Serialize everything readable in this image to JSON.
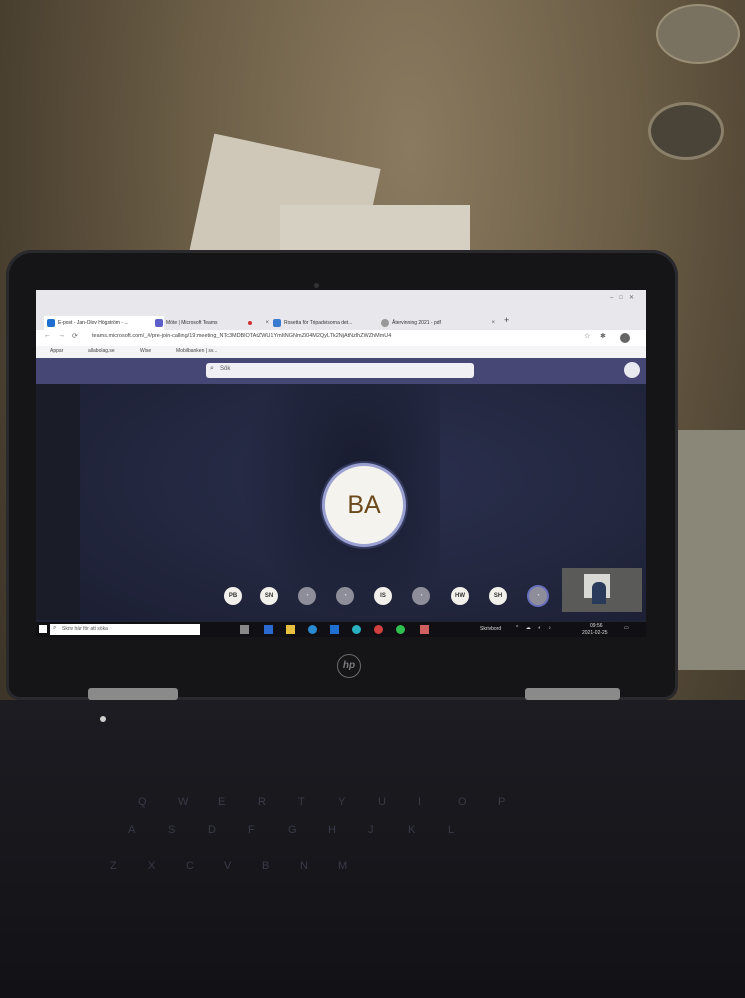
{
  "browser": {
    "tabs": [
      {
        "label": "E-post - Jan-Olov Högström - ..."
      },
      {
        "label": "Möte | Microsoft Teams"
      },
      {
        "label": "Rosetta för Tripadvisorna det..."
      },
      {
        "label": "Återvinning 2021 - pdf"
      }
    ],
    "new_tab": "+",
    "url": "teams.microsoft.com/_#/pre-join-calling/19:meeting_NTc3MDBlOTAtZWU1YmItNGNmZi04M2QyLTk2NjAtNzlhZWZhMmU4"
  },
  "bookmarks": [
    "Appar",
    "allabolag.se",
    "Wise",
    "Mobilbanken | sv..."
  ],
  "teams": {
    "search_placeholder": "Sök",
    "main_participant_initials": "BA",
    "participants": [
      {
        "initials": "PB",
        "has_initials": true
      },
      {
        "initials": "SN",
        "has_initials": true
      },
      {
        "initials": "",
        "has_initials": false
      },
      {
        "initials": "",
        "has_initials": false
      },
      {
        "initials": "IS",
        "has_initials": true
      },
      {
        "initials": "",
        "has_initials": false
      },
      {
        "initials": "HW",
        "has_initials": true
      },
      {
        "initials": "SH",
        "has_initials": true
      },
      {
        "initials": "",
        "has_initials": false
      }
    ]
  },
  "taskbar": {
    "search_placeholder": "Skriv här för att söka",
    "desktop_label": "Skrivbord",
    "time": "09:56",
    "date": "2021-02-25"
  },
  "laptop": {
    "brand": "hp"
  },
  "keyboard_keys": [
    "Q",
    "W",
    "E",
    "R",
    "T",
    "Y",
    "U",
    "I",
    "O",
    "P",
    "A",
    "S",
    "D",
    "F",
    "G",
    "H",
    "J",
    "K",
    "L",
    "Z",
    "X",
    "C",
    "V",
    "B",
    "N",
    "M"
  ]
}
